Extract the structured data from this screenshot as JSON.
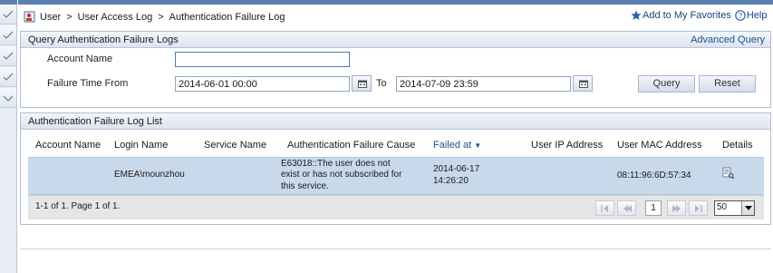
{
  "header": {
    "breadcrumb": [
      "User",
      "User Access Log",
      "Authentication Failure Log"
    ],
    "breadcrumb_sep": ">",
    "favorites_label": "Add to My Favorites",
    "help_label": "Help"
  },
  "query": {
    "title": "Query Authentication Failure Logs",
    "advanced_label": "Advanced Query",
    "account_name_label": "Account Name",
    "account_name_value": "",
    "failure_time_label": "Failure Time From",
    "from_value": "2014-06-01 00:00",
    "to_label": "To",
    "to_value": "2014-07-09 23:59",
    "query_button": "Query",
    "reset_button": "Reset"
  },
  "list": {
    "title": "Authentication Failure Log List",
    "columns": [
      "Account Name",
      "Login Name",
      "Service Name",
      "Authentication Failure Cause",
      "Failed at",
      "User IP Address",
      "User MAC Address",
      "Details"
    ],
    "sort_indicator": "▼",
    "rows": [
      {
        "account_name": "",
        "login_name": "EMEA\\mounzhou",
        "service_name": "",
        "cause_lines": [
          "E63018::The user does not",
          "exist or has not subscribed for",
          "this service."
        ],
        "failed_at_date": "2014-06-17",
        "failed_at_time": "14:26:20",
        "ip": "",
        "mac": "08:11:96:6D:57:34",
        "details_icon": "details-icon"
      }
    ],
    "pager": {
      "summary": "1-1 of 1. Page 1 of 1.",
      "current_page": "1",
      "page_size": "50"
    }
  },
  "colors": {
    "accent": "#5b7fb0",
    "row_selected": "#c9d9ec",
    "link": "#1f4f8f"
  }
}
